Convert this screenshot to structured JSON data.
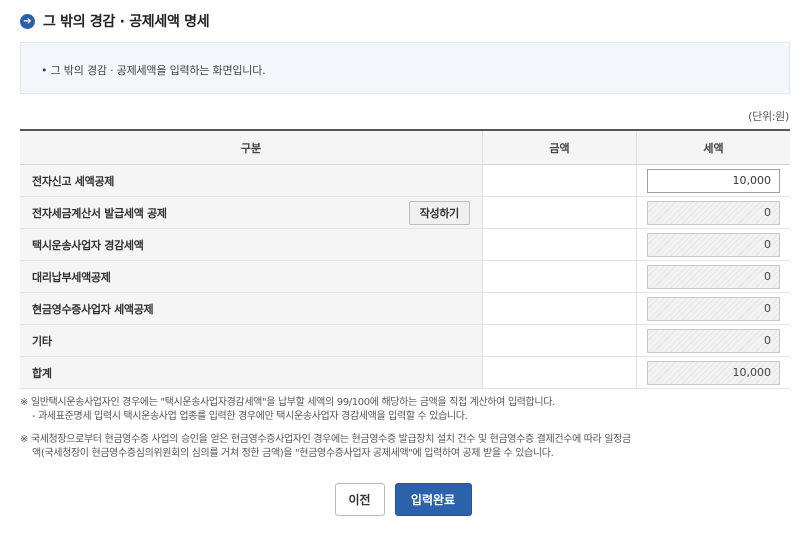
{
  "page": {
    "title_icon": "➔",
    "title": "그 밖의 경감 · 공제세액 명세",
    "info": "• 그 밖의 경감 · 공제세액을 입력하는 화면입니다.",
    "unit": "(단위:원)"
  },
  "table": {
    "headers": [
      "구분",
      "금액",
      "세액"
    ],
    "rows": [
      {
        "label": "전자신고 세액공제",
        "value": "10,000",
        "button": ""
      },
      {
        "label": "전자세금계산서 발급세액 공제",
        "value": "0",
        "button": "작성하기"
      },
      {
        "label": "택시운송사업자 경감세액",
        "value": "0",
        "button": ""
      },
      {
        "label": "대리납부세액공제",
        "value": "0",
        "button": ""
      },
      {
        "label": "현금영수증사업자 세액공제",
        "value": "0",
        "button": ""
      },
      {
        "label": "기타",
        "value": "0",
        "button": ""
      },
      {
        "label": "합계",
        "value": "10,000",
        "button": ""
      }
    ]
  },
  "notes": {
    "n1": "※ 일반택시운송사업자인 경우에는 \"택시운송사업자경감세액\"을 납부할 세액의 99/100에 해당하는 금액을 직접 계산하여 입력합니다.",
    "n2": "- 과세표준명세 입력시 택시운송사업 업종를 입력한 경우에만 택시운송사업자 경감세액을 입력할 수 있습니다.",
    "n3": "※ 국세청장으로부터 현금영수증 사업의 승인을 얻은 현금영수증사업자인 경우에는 현금영수증 발급장치 설치 건수 및 현금영수증 결제건수에 따라 일정금",
    "n4": "액(국세청장이 현금영수증심의위원회의 심의를 거쳐 정한 금액)을 \"현금영수증사업자 공제세액\"에 입력하여 공제 받을 수 있습니다."
  },
  "buttons": {
    "prev": "이전",
    "done": "입력완료"
  }
}
